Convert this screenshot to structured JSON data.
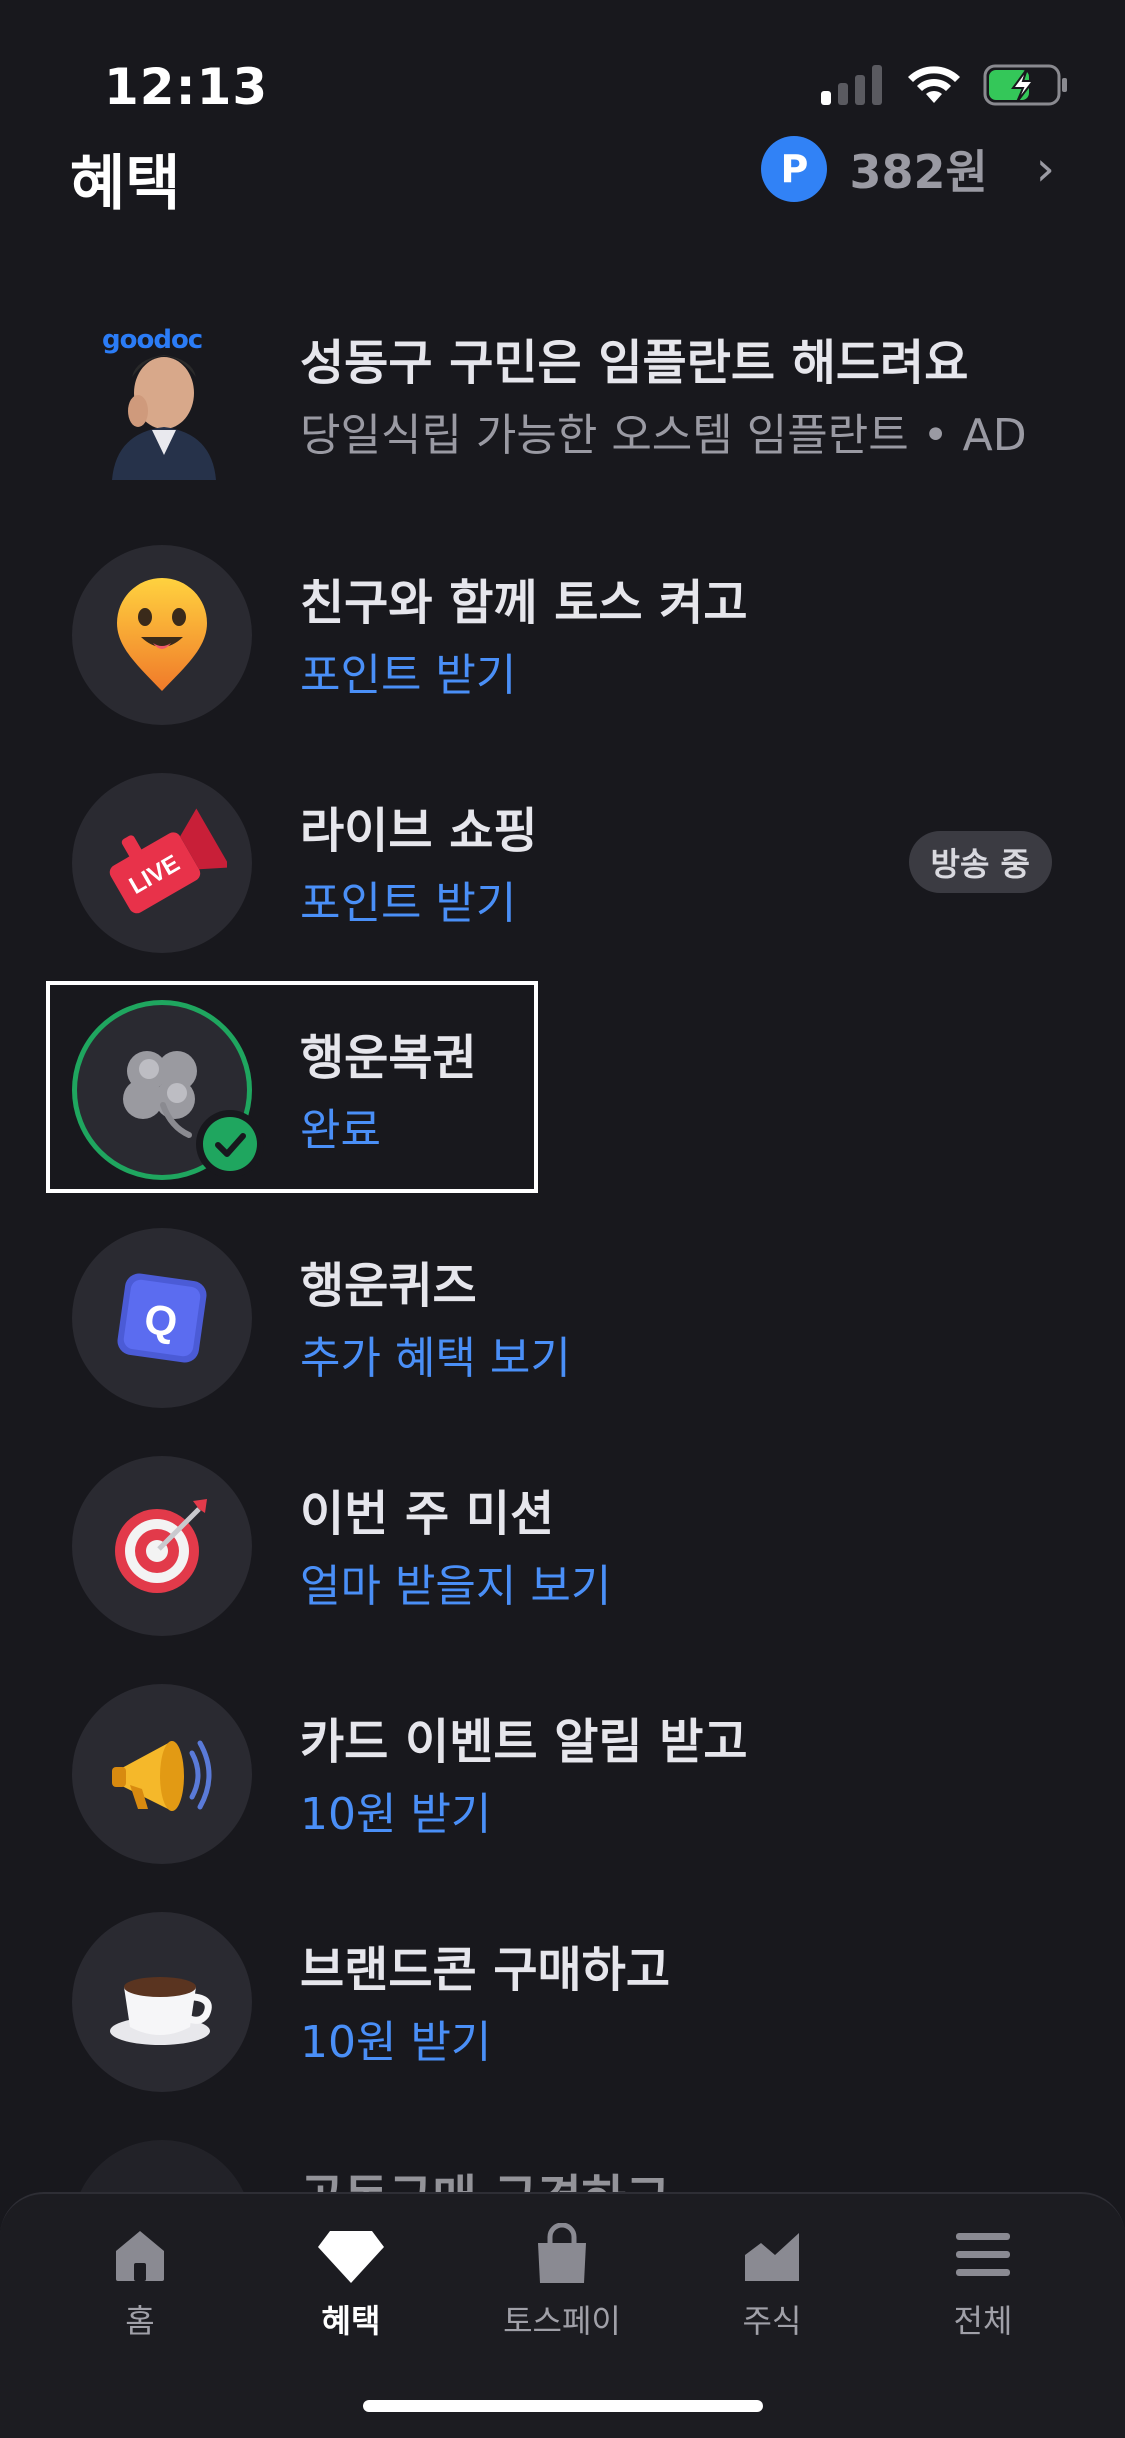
{
  "status_bar": {
    "time": "12:13"
  },
  "header": {
    "title": "혜택",
    "points_badge": "P",
    "points_value": "382원",
    "chevron": "›"
  },
  "items": [
    {
      "title": "성동구 구민은 임플란트 해드려요",
      "subtitle": "당일식립 가능한 오스템 임플란트 • AD",
      "logo_text": "goodoc",
      "icon": "ad-photo"
    },
    {
      "title": "친구와 함께 토스 켜고",
      "subtitle": "포인트 받기",
      "icon": "smiley-pin-icon"
    },
    {
      "title": "라이브 쇼핑",
      "subtitle": "포인트 받기",
      "badge": "방송 중",
      "icon": "live-megaphone-icon",
      "icon_text": "LIVE"
    },
    {
      "title": "행운복권",
      "subtitle": "완료",
      "icon": "clover-icon",
      "completed": true
    },
    {
      "title": "행운퀴즈",
      "subtitle": "추가 혜택 보기",
      "icon": "quiz-cube-icon",
      "icon_text": "Q"
    },
    {
      "title": "이번 주 미션",
      "subtitle": "얼마 받을지 보기",
      "icon": "target-icon"
    },
    {
      "title": "카드 이벤트 알림 받고",
      "subtitle": "10원 받기",
      "icon": "megaphone-icon"
    },
    {
      "title": "브랜드콘 구매하고",
      "subtitle": "10원 받기",
      "icon": "coffee-cup-icon"
    },
    {
      "title": "공동구매 구경하고",
      "icon": "partial-icon"
    }
  ],
  "bottom_nav": [
    {
      "label": "홈",
      "icon": "home-icon",
      "active": false
    },
    {
      "label": "혜택",
      "icon": "gem-icon",
      "active": true
    },
    {
      "label": "토스페이",
      "icon": "shopping-bag-icon",
      "active": false
    },
    {
      "label": "주식",
      "icon": "stock-chart-icon",
      "active": false
    },
    {
      "label": "전체",
      "icon": "menu-icon",
      "active": false
    }
  ],
  "colors": {
    "background": "#18181d",
    "accent_blue": "#3182f6",
    "link_blue": "#4a8ff7",
    "success_green": "#1fa65f"
  }
}
